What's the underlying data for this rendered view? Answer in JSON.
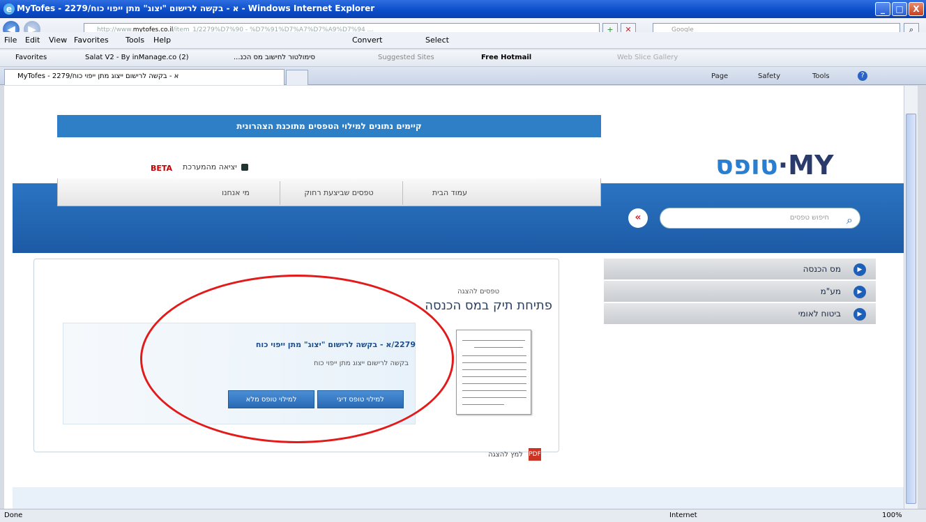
{
  "window": {
    "title": "MyTofes - 2279/א - בקשה לרישום \"יצוג\" מתן ייפוי כוח - Windows Internet Explorer",
    "ie_icon": "e",
    "min_label": "_",
    "max_label": "□",
    "close_label": "X"
  },
  "nav": {
    "back": "◀",
    "forward": "▶",
    "address_prefix": "http://www.",
    "address_host": "mytofes.co.il",
    "address_rest": "/item_1/2279%D7%90 - %D7%91%D7%A7%D7%A9%D7%94 ...",
    "go": "+",
    "stop": "✕",
    "search_placeholder": "Google",
    "search_btn": "⌕"
  },
  "menu": {
    "file": "File",
    "edit": "Edit",
    "view": "View",
    "favorites": "Favorites",
    "tools": "Tools",
    "help": "Help",
    "convert": "Convert",
    "select": "Select"
  },
  "favbar": {
    "favorites": "Favorites",
    "f1": "Salat V2 - By inManage.co (2)",
    "f2": "...סימולטור לחישוב מס הכנ",
    "f3": "Suggested Sites",
    "f4": "Free Hotmail",
    "f5": "Web Slice Gallery"
  },
  "tab": {
    "label": "MyTofes - 2279/א - בקשה לרישום ייצוג מתן ייפוי כוח",
    "close": "×"
  },
  "cmd": {
    "page": "Page",
    "safety": "Safety",
    "tools": "Tools",
    "help": "?"
  },
  "site": {
    "banner": "קיימים נתונים למילוי הטפסים מתוכנת הצהרונית",
    "logo_left": "MY",
    "logo_right": "טופס",
    "beta": "BETA",
    "logout": "יציאה מהמערכת",
    "tabs": [
      "עמוד הבית",
      "טפסים שביצעת רחוק",
      "מי אנחנו"
    ],
    "search_placeholder": "חיפוש טפסים",
    "collapse": "«",
    "forms_label": "טפסים להצגה",
    "page_title": "פתיחת תיק במס הכנסה",
    "form_title": "2279/א - בקשה לרישום \"יצוג\" מתן ייפוי כוח",
    "form_desc": "בקשה לרישום ייצוג מתן ייפוי כוח",
    "btn_fill_quick": "למילוי טופס דיגי",
    "btn_fill_full": "למילוי טופס מלא",
    "pdf_label": "למץ להצגה",
    "pdf_icon": "PDF",
    "side_menu": [
      "מס הכנסה",
      "מע\"מ",
      "ביטוח לאומי"
    ],
    "side_dot": "●"
  },
  "status": {
    "left": "Done",
    "zone": "Internet",
    "zoom": "100%"
  },
  "colors": {
    "banner": "#2f7fc6",
    "hero": "#1d5aa5",
    "annotation_circle": "#e31a1a"
  }
}
